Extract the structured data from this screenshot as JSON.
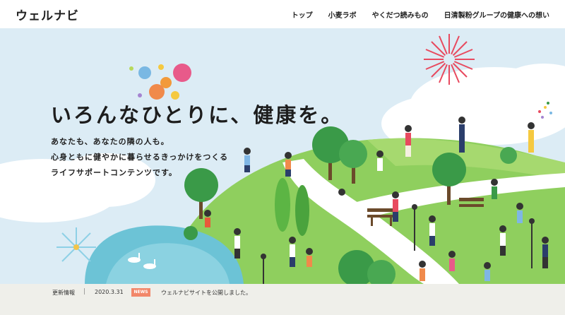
{
  "header": {
    "logo": "ウェルナビ",
    "nav": [
      "トップ",
      "小麦ラボ",
      "やくだつ読みもの",
      "日清製粉グループの健康への想い"
    ]
  },
  "hero": {
    "headline": "いろんなひとりに、健康を。",
    "lead": [
      "あなたも、あなたの隣の人も。",
      "心身ともに健やかに暮らせるきっかけをつくる",
      "ライフサポートコンテンツです。"
    ]
  },
  "news": {
    "label": "更新情報",
    "separator": "|",
    "date": "2020.3.31",
    "badge": "NEWS",
    "text": "ウェルナビサイトを公開しました。"
  },
  "colors": {
    "sky": "#dcecf5",
    "grass": "#8fcf5e",
    "path": "#ffffff",
    "pond": "#6cc3d6",
    "badge": "#f2876a"
  }
}
